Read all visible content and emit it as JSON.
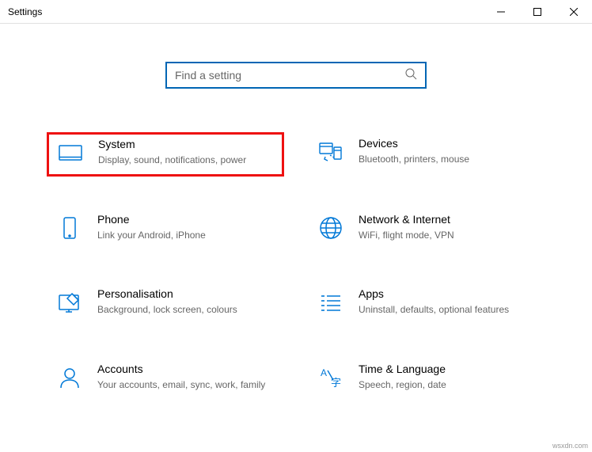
{
  "window": {
    "title": "Settings"
  },
  "search": {
    "placeholder": "Find a setting"
  },
  "tiles": [
    {
      "id": "system",
      "title": "System",
      "desc": "Display, sound, notifications, power",
      "highlight": true
    },
    {
      "id": "devices",
      "title": "Devices",
      "desc": "Bluetooth, printers, mouse",
      "highlight": false
    },
    {
      "id": "phone",
      "title": "Phone",
      "desc": "Link your Android, iPhone",
      "highlight": false
    },
    {
      "id": "network",
      "title": "Network & Internet",
      "desc": "WiFi, flight mode, VPN",
      "highlight": false
    },
    {
      "id": "personalisation",
      "title": "Personalisation",
      "desc": "Background, lock screen, colours",
      "highlight": false
    },
    {
      "id": "apps",
      "title": "Apps",
      "desc": "Uninstall, defaults, optional features",
      "highlight": false
    },
    {
      "id": "accounts",
      "title": "Accounts",
      "desc": "Your accounts, email, sync, work, family",
      "highlight": false
    },
    {
      "id": "time",
      "title": "Time & Language",
      "desc": "Speech, region, date",
      "highlight": false
    }
  ],
  "colors": {
    "accent": "#0078d7",
    "highlight": "#e11"
  },
  "watermark": "wsxdn.com"
}
